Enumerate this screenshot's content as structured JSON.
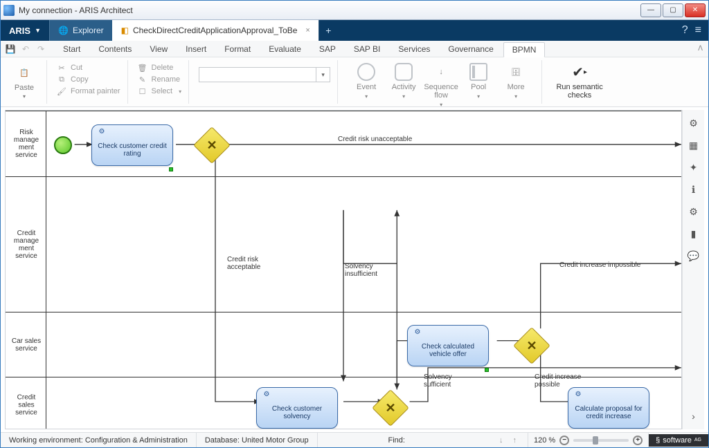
{
  "window": {
    "title": "My connection - ARIS Architect"
  },
  "appbar": {
    "brand": "ARIS",
    "tabs": {
      "explorer": "Explorer",
      "active": "CheckDirectCreditApplicationApproval_ToBe"
    }
  },
  "menu": {
    "items": [
      "Start",
      "Contents",
      "View",
      "Insert",
      "Format",
      "Evaluate",
      "SAP",
      "SAP BI",
      "Services",
      "Governance",
      "BPMN"
    ],
    "active": "BPMN"
  },
  "ribbon": {
    "paste": "Paste",
    "clipboard": {
      "cut": "Cut",
      "copy": "Copy",
      "format_painter": "Format painter"
    },
    "edit": {
      "delete": "Delete",
      "rename": "Rename",
      "select": "Select"
    },
    "bpmn_tools": {
      "event": "Event",
      "activity": "Activity",
      "sequence": "Sequence flow",
      "pool": "Pool",
      "more": "More"
    },
    "semantic": "Run semantic checks"
  },
  "lanes": {
    "l1": "Risk manage ment service",
    "l2": "Credit manage ment service",
    "l3": "Car sales service",
    "l4": "Credit sales service"
  },
  "tasks": {
    "t1": "Check customer credit rating",
    "t2": "Check customer solvency",
    "t3": "Check calculated vehicle offer",
    "t4": "Calculate proposal for credit increase"
  },
  "labels": {
    "unacceptable": "Credit risk unacceptable",
    "acceptable": "Credit risk acceptable",
    "solv_insuf": "Solvency insufficient",
    "solv_suf": "Solvency sufficient",
    "inc_imposs": "Credit increase impossible",
    "inc_poss": "Credit increase possible"
  },
  "status": {
    "env": "Working environment: Configuration & Administration",
    "db": "Database: United Motor Group",
    "find": "Find:",
    "zoom": "120 %",
    "brand": "software"
  },
  "colors": {
    "lane_border": "#333",
    "task_fill": "#cfe3fb",
    "gateway": "#ead94a"
  }
}
